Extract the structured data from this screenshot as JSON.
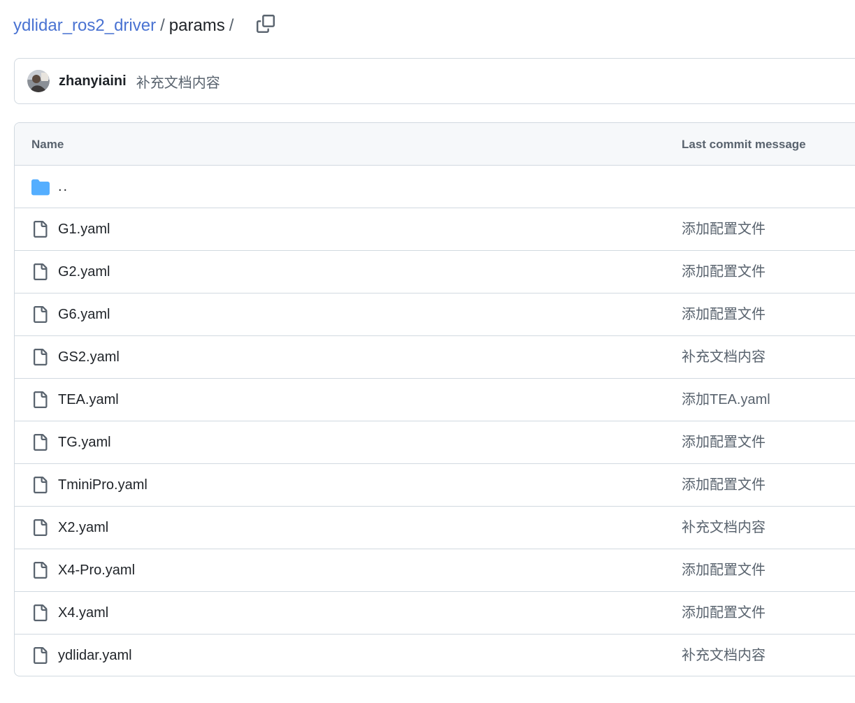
{
  "breadcrumb": {
    "repo": "ydlidar_ros2_driver",
    "separator": "/",
    "current": "params",
    "trailing_separator": "/",
    "copy_icon": "copy-icon"
  },
  "latest_commit": {
    "avatar_icon": "user-avatar",
    "author": "zhanyiaini",
    "message": "补充文档内容"
  },
  "table": {
    "headers": {
      "name": "Name",
      "last_commit_message": "Last commit message"
    },
    "parent_dir": {
      "icon": "folder-icon",
      "label": ".."
    },
    "files": [
      {
        "name": "G1.yaml",
        "message": "添加配置文件",
        "icon": "file-icon"
      },
      {
        "name": "G2.yaml",
        "message": "添加配置文件",
        "icon": "file-icon"
      },
      {
        "name": "G6.yaml",
        "message": "添加配置文件",
        "icon": "file-icon"
      },
      {
        "name": "GS2.yaml",
        "message": "补充文档内容",
        "icon": "file-icon"
      },
      {
        "name": "TEA.yaml",
        "message": "添加TEA.yaml",
        "icon": "file-icon"
      },
      {
        "name": "TG.yaml",
        "message": "添加配置文件",
        "icon": "file-icon"
      },
      {
        "name": "TminiPro.yaml",
        "message": "添加配置文件",
        "icon": "file-icon"
      },
      {
        "name": "X2.yaml",
        "message": "补充文档内容",
        "icon": "file-icon"
      },
      {
        "name": "X4-Pro.yaml",
        "message": "添加配置文件",
        "icon": "file-icon"
      },
      {
        "name": "X4.yaml",
        "message": "添加配置文件",
        "icon": "file-icon"
      },
      {
        "name": "ydlidar.yaml",
        "message": "补充文档内容",
        "icon": "file-icon"
      }
    ]
  },
  "colors": {
    "link": "#4a73d2",
    "text": "#1f2328",
    "muted": "#59636e",
    "border": "#d1d9e0",
    "header_bg": "#f6f8fa",
    "folder": "#54aeff"
  }
}
